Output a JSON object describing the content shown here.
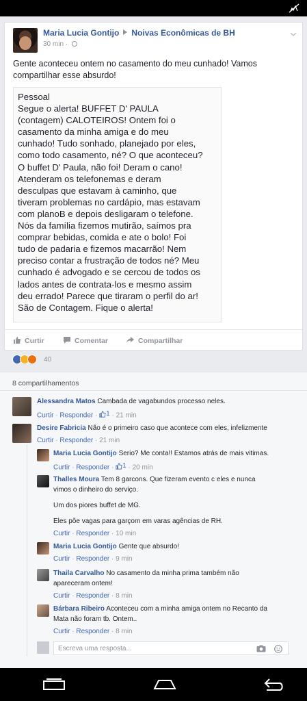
{
  "post": {
    "author": "Maria Lucia Gontijo",
    "group": "Noivas Econômicas de BH",
    "time": "30 min",
    "text": "Gente aconteceu ontem no casamento do meu cunhado! Vamos compartilhar esse absurdo!",
    "image_lines": [
      "Pessoal",
      "Segue o alerta! BUFFET D' PAULA",
      "(contagem) CALOTEIROS! Ontem foi o",
      "casamento da minha amiga e do meu",
      "cunhado! Tudo sonhado, planejado por eles,",
      "como todo casamento, né? O que aconteceu?",
      "O buffet D' Paula, não foi! Deram o cano!",
      "Atenderam os telefonemas e deram",
      "desculpas que estavam à caminho, que",
      "tiveram problemas no cardápio, mas estavam",
      "com planoB e depois desligaram o telefone.",
      "Nós da família fizemos mutirão, saímos pra",
      "comprar bebidas, comida e ate o bolo! Foi",
      "tudo de padaria e fizemos macarrão! Nem",
      "preciso contar a frustração de todos né? Meu",
      "cunhado é advogado e se cercou de todos os",
      "lados antes de contrata-los e mesmo assim",
      "deu errado! Parece que tiraram o perfil do ar!",
      "São de Contagem. Fique o alerta!"
    ],
    "actions": {
      "like": "Curtir",
      "comment": "Comentar",
      "share": "Compartilhar"
    }
  },
  "reactions": {
    "count": "40"
  },
  "shares": "8 compartilhamentos",
  "comments": [
    {
      "name": "Alessandra Matos",
      "text": "Cambada de vagabundos processo neles.",
      "like": "Curtir",
      "reply": "Responder",
      "likes": "1",
      "time": "21 min"
    },
    {
      "name": "Desire Fabricia",
      "text": "Não é o primeiro caso que acontece com eles, infelizmente",
      "like": "Curtir",
      "reply": "Responder",
      "time": "21 min"
    },
    {
      "name": "Maria Lucia Gontijo",
      "text": "Serio? Me conta!! Estamos atrás de mais vitimas.",
      "like": "Curtir",
      "reply": "Responder",
      "likes": "1",
      "time": "20 min"
    },
    {
      "name": "Thalles Moura",
      "text": "Tem 8 garcons. Que fizeram evento c eles e nunca vimos o dinheiro do serviço.",
      "text2": "Um dos piores buffet de MG.",
      "text3": "Eles põe vagas para garçom em varas agências de RH.",
      "like": "Curtir",
      "reply": "Responder",
      "time": "10 min"
    },
    {
      "name": "Maria Lucia Gontijo",
      "text": "Gente que absurdo!",
      "like": "Curtir",
      "reply": "Responder",
      "time": "9 min"
    },
    {
      "name": "Thaila Carvalho",
      "text": "No casamento da minha prima também não apareceram ontem!",
      "like": "Curtir",
      "reply": "Responder",
      "time": "8 min"
    },
    {
      "name": "Bárbara Ribeiro",
      "text": "Aconteceu com a minha amiga ontem no Recanto da Mata não foram tb. Ontem..",
      "like": "Curtir",
      "reply": "Responder",
      "time": "8 min"
    }
  ],
  "reply_box": {
    "placeholder": "Escreva uma resposta..."
  },
  "colors": {
    "link": "#365899",
    "meta": "#90949c",
    "like_blue": "#4267b2",
    "background": "#e9ebee"
  }
}
